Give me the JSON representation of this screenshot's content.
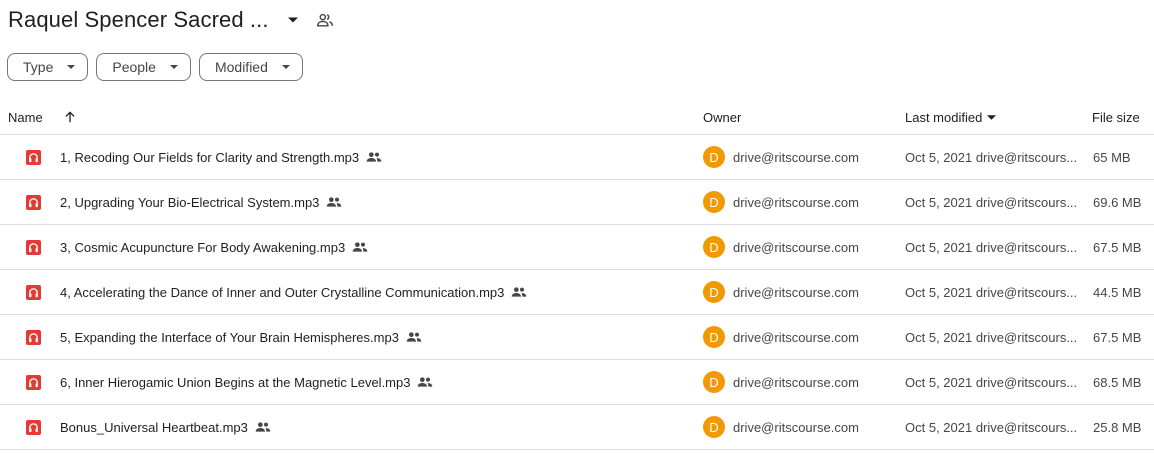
{
  "folder": {
    "title": "Raquel Spencer Sacred ..."
  },
  "filters": {
    "type": "Type",
    "people": "People",
    "modified": "Modified"
  },
  "columns": {
    "name": "Name",
    "owner": "Owner",
    "last_modified": "Last modified",
    "file_size": "File size"
  },
  "icons": {
    "file": "headphones-audio-icon",
    "shared": "people-icon"
  },
  "colors": {
    "file_icon": "#e53935",
    "avatar": "#f29900"
  },
  "files": [
    {
      "name": "1, Recoding Our Fields for Clarity and Strength.mp3",
      "avatar_initial": "D",
      "owner": "drive@ritscourse.com",
      "modified": "Oct 5, 2021 drive@ritscours...",
      "size": "65 MB"
    },
    {
      "name": "2, Upgrading Your Bio-Electrical System.mp3",
      "avatar_initial": "D",
      "owner": "drive@ritscourse.com",
      "modified": "Oct 5, 2021 drive@ritscours...",
      "size": "69.6 MB"
    },
    {
      "name": "3, Cosmic Acupuncture For Body Awakening.mp3",
      "avatar_initial": "D",
      "owner": "drive@ritscourse.com",
      "modified": "Oct 5, 2021 drive@ritscours...",
      "size": "67.5 MB"
    },
    {
      "name": "4, Accelerating the Dance of Inner and Outer Crystalline Communication.mp3",
      "avatar_initial": "D",
      "owner": "drive@ritscourse.com",
      "modified": "Oct 5, 2021 drive@ritscours...",
      "size": "44.5 MB"
    },
    {
      "name": "5, Expanding the Interface of Your Brain Hemispheres.mp3",
      "avatar_initial": "D",
      "owner": "drive@ritscourse.com",
      "modified": "Oct 5, 2021 drive@ritscours...",
      "size": "67.5 MB"
    },
    {
      "name": "6, Inner Hierogamic Union Begins at the Magnetic Level.mp3",
      "avatar_initial": "D",
      "owner": "drive@ritscourse.com",
      "modified": "Oct 5, 2021 drive@ritscours...",
      "size": "68.5 MB"
    },
    {
      "name": "Bonus_Universal Heartbeat.mp3",
      "avatar_initial": "D",
      "owner": "drive@ritscourse.com",
      "modified": "Oct 5, 2021 drive@ritscours...",
      "size": "25.8 MB"
    }
  ]
}
